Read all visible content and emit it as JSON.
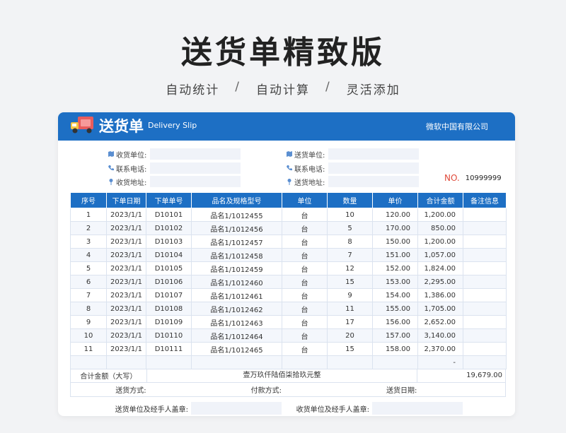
{
  "hero": {
    "title": "送货单精致版",
    "features": [
      "自动统计",
      "自动计算",
      "灵活添加"
    ],
    "separator": "/"
  },
  "header": {
    "title": "送货单",
    "title_en": "Delivery Slip",
    "company": "微软中国有限公司"
  },
  "info": {
    "receiver_unit": "收货单位:",
    "contact_phone": "联系电话:",
    "receiver_addr": "收货地址:",
    "sender_unit": "送货单位:",
    "sender_phone": "联系电话:",
    "sender_addr": "送货地址:",
    "no_label": "NO.",
    "no_value": "10999999"
  },
  "table": {
    "headers": [
      "序号",
      "下单日期",
      "下单单号",
      "品名及规格型号",
      "单位",
      "数量",
      "单价",
      "合计金额",
      "备注信息"
    ],
    "rows": [
      [
        "1",
        "2023/1/1",
        "D10101",
        "品名1/1012455",
        "台",
        "10",
        "120.00",
        "1,200.00",
        ""
      ],
      [
        "2",
        "2023/1/1",
        "D10102",
        "品名1/1012456",
        "台",
        "5",
        "170.00",
        "850.00",
        ""
      ],
      [
        "3",
        "2023/1/1",
        "D10103",
        "品名1/1012457",
        "台",
        "8",
        "150.00",
        "1,200.00",
        ""
      ],
      [
        "4",
        "2023/1/1",
        "D10104",
        "品名1/1012458",
        "台",
        "7",
        "151.00",
        "1,057.00",
        ""
      ],
      [
        "5",
        "2023/1/1",
        "D10105",
        "品名1/1012459",
        "台",
        "12",
        "152.00",
        "1,824.00",
        ""
      ],
      [
        "6",
        "2023/1/1",
        "D10106",
        "品名1/1012460",
        "台",
        "15",
        "153.00",
        "2,295.00",
        ""
      ],
      [
        "7",
        "2023/1/1",
        "D10107",
        "品名1/1012461",
        "台",
        "9",
        "154.00",
        "1,386.00",
        ""
      ],
      [
        "8",
        "2023/1/1",
        "D10108",
        "品名1/1012462",
        "台",
        "11",
        "155.00",
        "1,705.00",
        ""
      ],
      [
        "9",
        "2023/1/1",
        "D10109",
        "品名1/1012463",
        "台",
        "17",
        "156.00",
        "2,652.00",
        ""
      ],
      [
        "10",
        "2023/1/1",
        "D10110",
        "品名1/1012464",
        "台",
        "20",
        "157.00",
        "3,140.00",
        ""
      ],
      [
        "11",
        "2023/1/1",
        "D10111",
        "品名1/1012465",
        "台",
        "15",
        "158.00",
        "2,370.00",
        ""
      ]
    ],
    "empty_row_total": "-"
  },
  "summary": {
    "total_label": "合计金额（大写）",
    "total_words": "壹万玖仟陆佰柒拾玖元整",
    "total_value": "19,679.00",
    "delivery_method": "送货方式:",
    "payment_method": "付款方式:",
    "delivery_date": "送货日期:"
  },
  "sign": {
    "sender_sign": "送货单位及经手人盖章:",
    "receiver_sign": "收货单位及经手人盖章:"
  },
  "colors": {
    "primary": "#1d6fc4",
    "accent_red": "#e04a3a"
  }
}
